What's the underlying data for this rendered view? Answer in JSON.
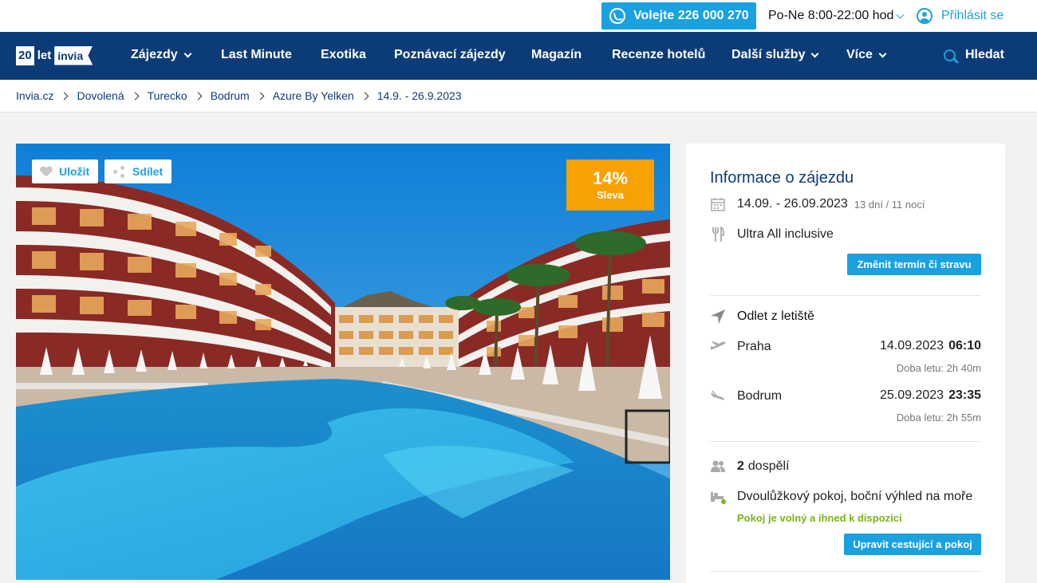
{
  "topbar": {
    "phone_label": "Volejte 226 000 270",
    "hours_label": "Po-Ne 8:00-22:00 hod",
    "login_label": "Přihlásit se"
  },
  "logo": {
    "years": "20",
    "let": "let",
    "brand": "invia"
  },
  "nav": {
    "items": [
      {
        "label": "Zájezdy"
      },
      {
        "label": "Last Minute"
      },
      {
        "label": "Exotika"
      },
      {
        "label": "Poznávací zájezdy"
      },
      {
        "label": "Magazín"
      },
      {
        "label": "Recenze hotelů"
      },
      {
        "label": "Další služby"
      },
      {
        "label": "Více"
      }
    ],
    "search_label": "Hledat"
  },
  "breadcrumb": [
    "Invia.cz",
    "Dovolená",
    "Turecko",
    "Bodrum",
    "Azure By Yelken",
    "14.9. - 26.9.2023"
  ],
  "photo": {
    "save_label": "Uložit",
    "share_label": "Sdílet",
    "discount_value": "14%",
    "discount_label": "Sleva"
  },
  "info": {
    "title": "Informace o zájezdu",
    "dates": "14.09. - 26.09.2023",
    "duration": "13 dní / 11 nocí",
    "board": "Ultra All inclusive",
    "change_btn": "Změnit termín či stravu",
    "departure_title": "Odlet z letiště",
    "outbound": {
      "city": "Praha",
      "date": "14.09.2023",
      "time": "06:10",
      "flight_time": "Doba letu: 2h 40m"
    },
    "inbound": {
      "city": "Bodrum",
      "date": "25.09.2023",
      "time": "23:35",
      "flight_time": "Doba letu: 2h 55m"
    },
    "adults_count": "2",
    "adults_label": "dospělí",
    "room": "Dvoulůžkový pokoj, boční výhled na moře",
    "room_status": "Pokoj je volný a ihned k dispozici",
    "edit_btn": "Upravit cestující a pokoj"
  },
  "colors": {
    "navy": "#0c3c78",
    "accent": "#1aa1e0",
    "discount": "#f8a102",
    "available": "#7ab317"
  }
}
